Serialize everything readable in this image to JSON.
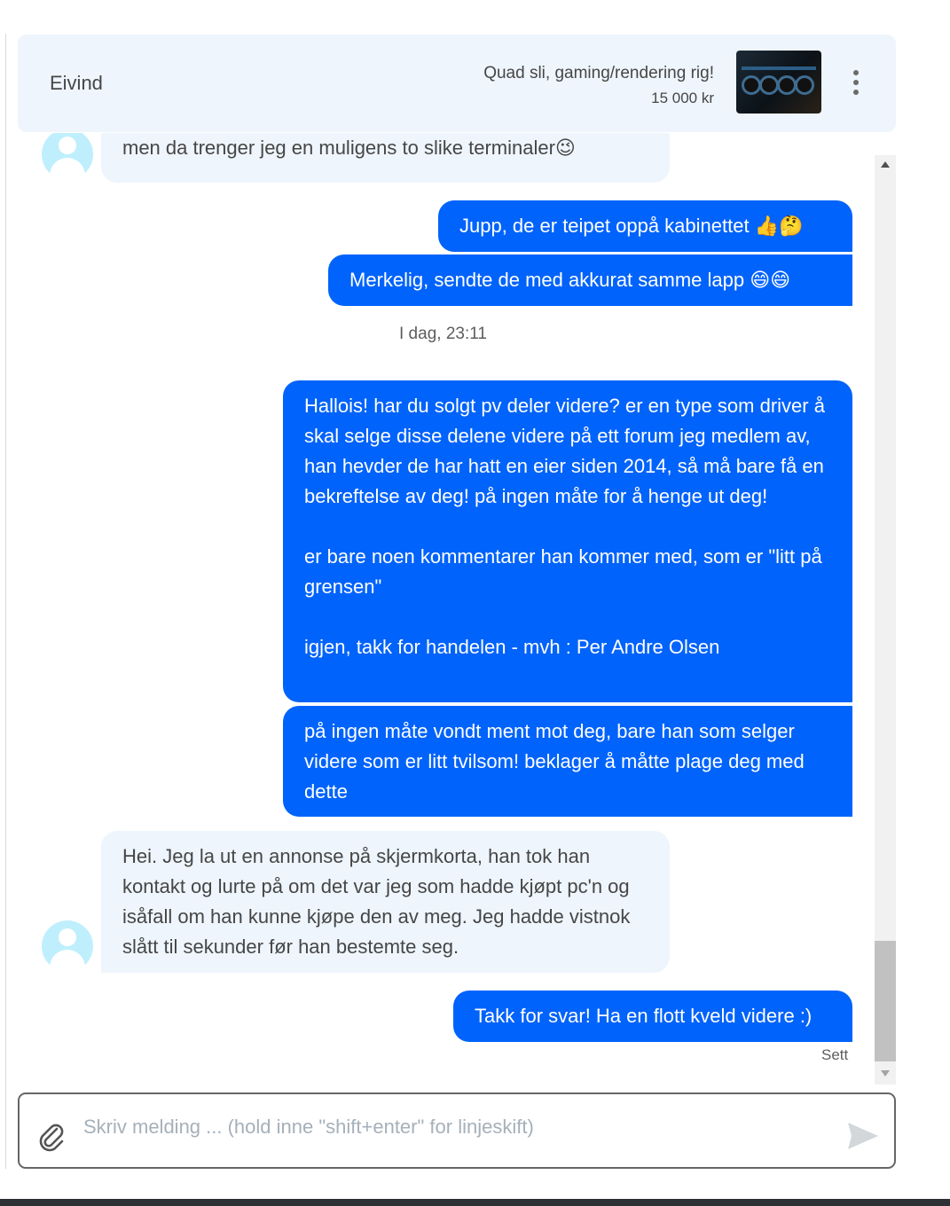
{
  "header": {
    "contact_name": "Eivind",
    "ad_title": "Quad sli, gaming/rendering rig!",
    "ad_price": "15 000 kr",
    "thumbnail_icon": "computer-hardware-photo",
    "menu_icon": "vertical-dots-icon"
  },
  "messages": {
    "partial_in": "men da trenger jeg en muligens to slike terminaler😉",
    "out_1": "Jupp, de er teipet oppå kabinettet 👍🤔",
    "out_2": "Merkelig, sendte de med akkurat samme lapp 😄😄",
    "timestamp": "I dag, 23:11",
    "out_3": "Hallois! har du solgt pv deler videre? er en type som driver å skal selge disse delene videre på ett forum jeg medlem av, han hevder de har hatt en eier siden 2014, så må bare få en bekreftelse av deg! på ingen måte for å henge ut deg!\n\ner bare noen kommentarer han kommer med, som er \"litt på grensen\"\n\nigjen, takk for handelen - mvh : Per Andre Olsen",
    "out_4": "på ingen måte vondt ment mot deg, bare han som selger videre som er litt tvilsom! beklager å måtte plage deg med dette",
    "in_1": "Hei. Jeg la ut en annonse på skjermkorta, han tok han kontakt og lurte på om det var jeg som hadde kjøpt pc'n og isåfall om han kunne kjøpe den av meg. Jeg hadde vistnok slått til sekunder før han bestemte seg.",
    "out_5": "Takk for svar! Ha en flott kveld videre :)",
    "status": "Sett"
  },
  "composer": {
    "placeholder": "Skriv melding ... (hold inne \"shift+enter\" for linjeskift)",
    "value": "",
    "attach_icon": "paperclip-icon",
    "send_icon": "send-arrow-icon"
  },
  "colors": {
    "outgoing_bubble": "#0063fb",
    "incoming_bubble": "#eef5fc",
    "header_bg": "#eef5fc",
    "avatar": "#bfeffc"
  }
}
